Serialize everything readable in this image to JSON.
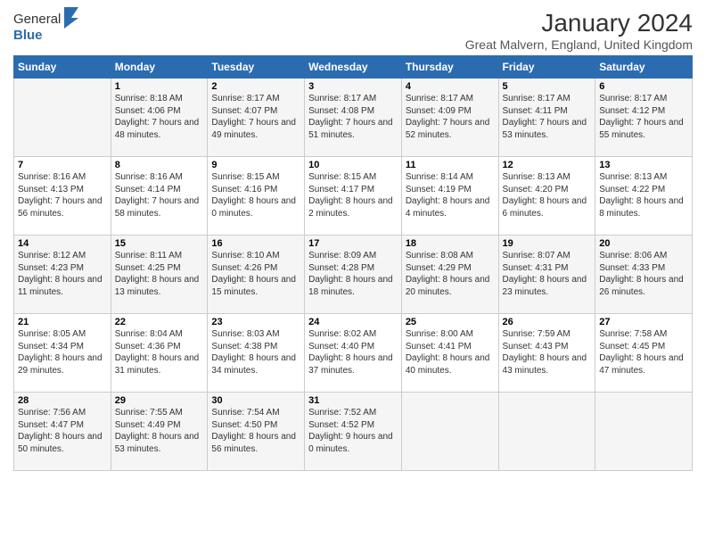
{
  "header": {
    "logo_general": "General",
    "logo_blue": "Blue",
    "month_year": "January 2024",
    "location": "Great Malvern, England, United Kingdom"
  },
  "days_of_week": [
    "Sunday",
    "Monday",
    "Tuesday",
    "Wednesday",
    "Thursday",
    "Friday",
    "Saturday"
  ],
  "weeks": [
    [
      {
        "num": "",
        "sunrise": "",
        "sunset": "",
        "daylight": ""
      },
      {
        "num": "1",
        "sunrise": "Sunrise: 8:18 AM",
        "sunset": "Sunset: 4:06 PM",
        "daylight": "Daylight: 7 hours and 48 minutes."
      },
      {
        "num": "2",
        "sunrise": "Sunrise: 8:17 AM",
        "sunset": "Sunset: 4:07 PM",
        "daylight": "Daylight: 7 hours and 49 minutes."
      },
      {
        "num": "3",
        "sunrise": "Sunrise: 8:17 AM",
        "sunset": "Sunset: 4:08 PM",
        "daylight": "Daylight: 7 hours and 51 minutes."
      },
      {
        "num": "4",
        "sunrise": "Sunrise: 8:17 AM",
        "sunset": "Sunset: 4:09 PM",
        "daylight": "Daylight: 7 hours and 52 minutes."
      },
      {
        "num": "5",
        "sunrise": "Sunrise: 8:17 AM",
        "sunset": "Sunset: 4:11 PM",
        "daylight": "Daylight: 7 hours and 53 minutes."
      },
      {
        "num": "6",
        "sunrise": "Sunrise: 8:17 AM",
        "sunset": "Sunset: 4:12 PM",
        "daylight": "Daylight: 7 hours and 55 minutes."
      }
    ],
    [
      {
        "num": "7",
        "sunrise": "Sunrise: 8:16 AM",
        "sunset": "Sunset: 4:13 PM",
        "daylight": "Daylight: 7 hours and 56 minutes."
      },
      {
        "num": "8",
        "sunrise": "Sunrise: 8:16 AM",
        "sunset": "Sunset: 4:14 PM",
        "daylight": "Daylight: 7 hours and 58 minutes."
      },
      {
        "num": "9",
        "sunrise": "Sunrise: 8:15 AM",
        "sunset": "Sunset: 4:16 PM",
        "daylight": "Daylight: 8 hours and 0 minutes."
      },
      {
        "num": "10",
        "sunrise": "Sunrise: 8:15 AM",
        "sunset": "Sunset: 4:17 PM",
        "daylight": "Daylight: 8 hours and 2 minutes."
      },
      {
        "num": "11",
        "sunrise": "Sunrise: 8:14 AM",
        "sunset": "Sunset: 4:19 PM",
        "daylight": "Daylight: 8 hours and 4 minutes."
      },
      {
        "num": "12",
        "sunrise": "Sunrise: 8:13 AM",
        "sunset": "Sunset: 4:20 PM",
        "daylight": "Daylight: 8 hours and 6 minutes."
      },
      {
        "num": "13",
        "sunrise": "Sunrise: 8:13 AM",
        "sunset": "Sunset: 4:22 PM",
        "daylight": "Daylight: 8 hours and 8 minutes."
      }
    ],
    [
      {
        "num": "14",
        "sunrise": "Sunrise: 8:12 AM",
        "sunset": "Sunset: 4:23 PM",
        "daylight": "Daylight: 8 hours and 11 minutes."
      },
      {
        "num": "15",
        "sunrise": "Sunrise: 8:11 AM",
        "sunset": "Sunset: 4:25 PM",
        "daylight": "Daylight: 8 hours and 13 minutes."
      },
      {
        "num": "16",
        "sunrise": "Sunrise: 8:10 AM",
        "sunset": "Sunset: 4:26 PM",
        "daylight": "Daylight: 8 hours and 15 minutes."
      },
      {
        "num": "17",
        "sunrise": "Sunrise: 8:09 AM",
        "sunset": "Sunset: 4:28 PM",
        "daylight": "Daylight: 8 hours and 18 minutes."
      },
      {
        "num": "18",
        "sunrise": "Sunrise: 8:08 AM",
        "sunset": "Sunset: 4:29 PM",
        "daylight": "Daylight: 8 hours and 20 minutes."
      },
      {
        "num": "19",
        "sunrise": "Sunrise: 8:07 AM",
        "sunset": "Sunset: 4:31 PM",
        "daylight": "Daylight: 8 hours and 23 minutes."
      },
      {
        "num": "20",
        "sunrise": "Sunrise: 8:06 AM",
        "sunset": "Sunset: 4:33 PM",
        "daylight": "Daylight: 8 hours and 26 minutes."
      }
    ],
    [
      {
        "num": "21",
        "sunrise": "Sunrise: 8:05 AM",
        "sunset": "Sunset: 4:34 PM",
        "daylight": "Daylight: 8 hours and 29 minutes."
      },
      {
        "num": "22",
        "sunrise": "Sunrise: 8:04 AM",
        "sunset": "Sunset: 4:36 PM",
        "daylight": "Daylight: 8 hours and 31 minutes."
      },
      {
        "num": "23",
        "sunrise": "Sunrise: 8:03 AM",
        "sunset": "Sunset: 4:38 PM",
        "daylight": "Daylight: 8 hours and 34 minutes."
      },
      {
        "num": "24",
        "sunrise": "Sunrise: 8:02 AM",
        "sunset": "Sunset: 4:40 PM",
        "daylight": "Daylight: 8 hours and 37 minutes."
      },
      {
        "num": "25",
        "sunrise": "Sunrise: 8:00 AM",
        "sunset": "Sunset: 4:41 PM",
        "daylight": "Daylight: 8 hours and 40 minutes."
      },
      {
        "num": "26",
        "sunrise": "Sunrise: 7:59 AM",
        "sunset": "Sunset: 4:43 PM",
        "daylight": "Daylight: 8 hours and 43 minutes."
      },
      {
        "num": "27",
        "sunrise": "Sunrise: 7:58 AM",
        "sunset": "Sunset: 4:45 PM",
        "daylight": "Daylight: 8 hours and 47 minutes."
      }
    ],
    [
      {
        "num": "28",
        "sunrise": "Sunrise: 7:56 AM",
        "sunset": "Sunset: 4:47 PM",
        "daylight": "Daylight: 8 hours and 50 minutes."
      },
      {
        "num": "29",
        "sunrise": "Sunrise: 7:55 AM",
        "sunset": "Sunset: 4:49 PM",
        "daylight": "Daylight: 8 hours and 53 minutes."
      },
      {
        "num": "30",
        "sunrise": "Sunrise: 7:54 AM",
        "sunset": "Sunset: 4:50 PM",
        "daylight": "Daylight: 8 hours and 56 minutes."
      },
      {
        "num": "31",
        "sunrise": "Sunrise: 7:52 AM",
        "sunset": "Sunset: 4:52 PM",
        "daylight": "Daylight: 9 hours and 0 minutes."
      },
      {
        "num": "",
        "sunrise": "",
        "sunset": "",
        "daylight": ""
      },
      {
        "num": "",
        "sunrise": "",
        "sunset": "",
        "daylight": ""
      },
      {
        "num": "",
        "sunrise": "",
        "sunset": "",
        "daylight": ""
      }
    ]
  ]
}
